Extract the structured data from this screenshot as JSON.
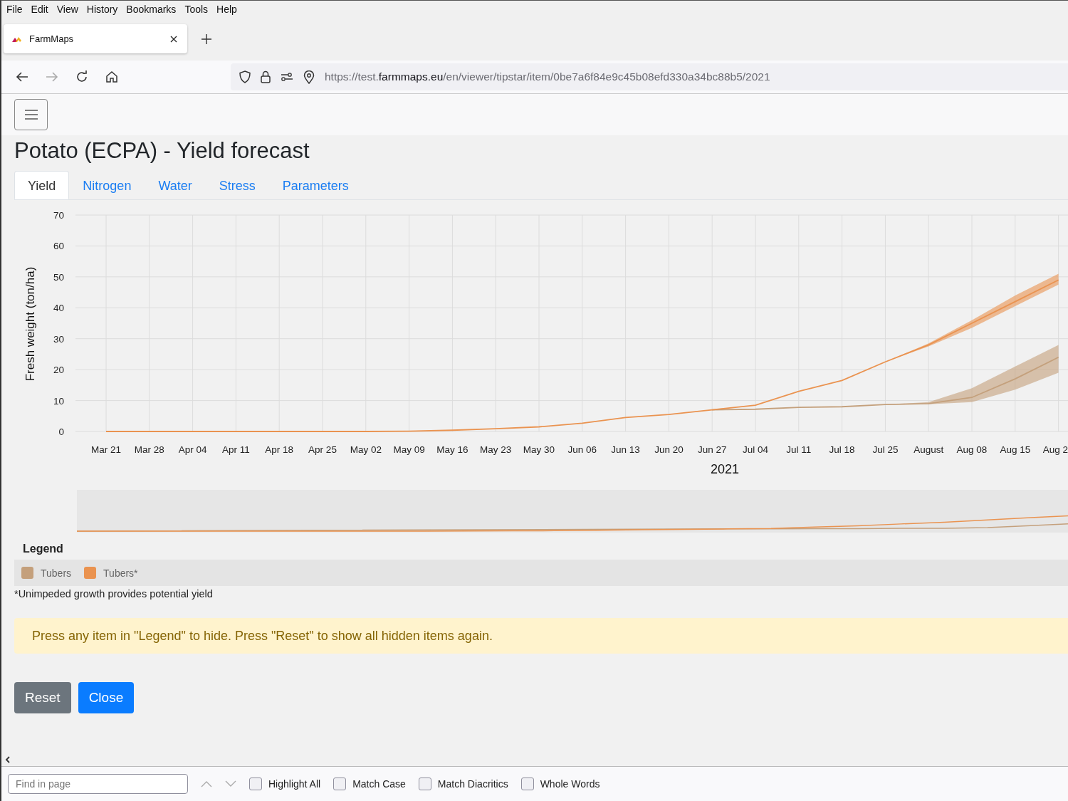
{
  "menu": [
    "File",
    "Edit",
    "View",
    "History",
    "Bookmarks",
    "Tools",
    "Help"
  ],
  "browser_tab": {
    "title": "FarmMaps"
  },
  "address_bar": {
    "url_scheme": "https://test.",
    "url_domain": "farmmaps.eu",
    "url_path": "/en/viewer/tipstar/item/0be7a6f84e9c45b08efd330a34bc88b5/2021"
  },
  "page": {
    "title": "Potato (ECPA) - Yield forecast",
    "tabs": [
      {
        "label": "Yield",
        "selected": true
      },
      {
        "label": "Nitrogen",
        "selected": false
      },
      {
        "label": "Water",
        "selected": false
      },
      {
        "label": "Stress",
        "selected": false
      },
      {
        "label": "Parameters",
        "selected": false
      }
    ],
    "chart_data": {
      "type": "line",
      "xlabel": "2021",
      "ylabel": "Fresh weight (ton/ha)",
      "categories": [
        "Mar 21",
        "Mar 28",
        "Apr 04",
        "Apr 11",
        "Apr 18",
        "Apr 25",
        "May 02",
        "May 09",
        "May 16",
        "May 23",
        "May 30",
        "Jun 06",
        "Jun 13",
        "Jun 20",
        "Jun 27",
        "Jul 04",
        "Jul 11",
        "Jul 18",
        "Jul 25",
        "August",
        "Aug 08",
        "Aug 15",
        "Aug 2"
      ],
      "series": [
        {
          "name": "Tubers",
          "color": "#c4a07c",
          "values": [
            null,
            null,
            null,
            null,
            null,
            null,
            null,
            null,
            null,
            null,
            null,
            null,
            null,
            null,
            7,
            7.2,
            7.8,
            8,
            8.7,
            9,
            11,
            17,
            24
          ],
          "lower": [
            null,
            null,
            null,
            null,
            null,
            null,
            null,
            null,
            null,
            null,
            null,
            null,
            null,
            null,
            null,
            null,
            null,
            null,
            8.7,
            8.8,
            9.5,
            13.5,
            19
          ],
          "upper": [
            null,
            null,
            null,
            null,
            null,
            null,
            null,
            null,
            null,
            null,
            null,
            null,
            null,
            null,
            null,
            null,
            null,
            null,
            8.7,
            9.5,
            14,
            21,
            28
          ]
        },
        {
          "name": "Tubers*",
          "color": "#ea9350",
          "values": [
            0,
            0,
            0,
            0,
            0,
            0,
            0,
            0.1,
            0.4,
            0.9,
            1.5,
            2.7,
            4.5,
            5.5,
            7,
            8.5,
            13,
            16.5,
            22.5,
            28,
            35,
            42,
            49
          ],
          "lower": [
            null,
            null,
            null,
            null,
            null,
            null,
            null,
            null,
            null,
            null,
            null,
            null,
            null,
            null,
            null,
            null,
            null,
            null,
            22.5,
            27.5,
            33.5,
            40.5,
            47.5
          ],
          "upper": [
            null,
            null,
            null,
            null,
            null,
            null,
            null,
            null,
            null,
            null,
            null,
            null,
            null,
            null,
            null,
            null,
            null,
            null,
            22.5,
            28.5,
            36,
            44,
            51
          ]
        }
      ],
      "ylim": [
        0,
        70
      ],
      "yticks": [
        0,
        10,
        20,
        30,
        40,
        50,
        60,
        70
      ],
      "grid": true
    },
    "legend": {
      "title": "Legend"
    },
    "footnote": "*Unimpeded growth provides potential yield",
    "alert": "Press any item in \"Legend\" to hide. Press \"Reset\" to show all hidden items again.",
    "buttons": [
      {
        "label": "Reset",
        "kind": "secondary"
      },
      {
        "label": "Close",
        "kind": "primary"
      }
    ]
  },
  "find_bar": {
    "placeholder": "Find in page",
    "options": [
      {
        "label": "Highlight All",
        "checked": false
      },
      {
        "label": "Match Case",
        "checked": false
      },
      {
        "label": "Match Diacritics",
        "checked": false
      },
      {
        "label": "Whole Words",
        "checked": false
      }
    ]
  }
}
